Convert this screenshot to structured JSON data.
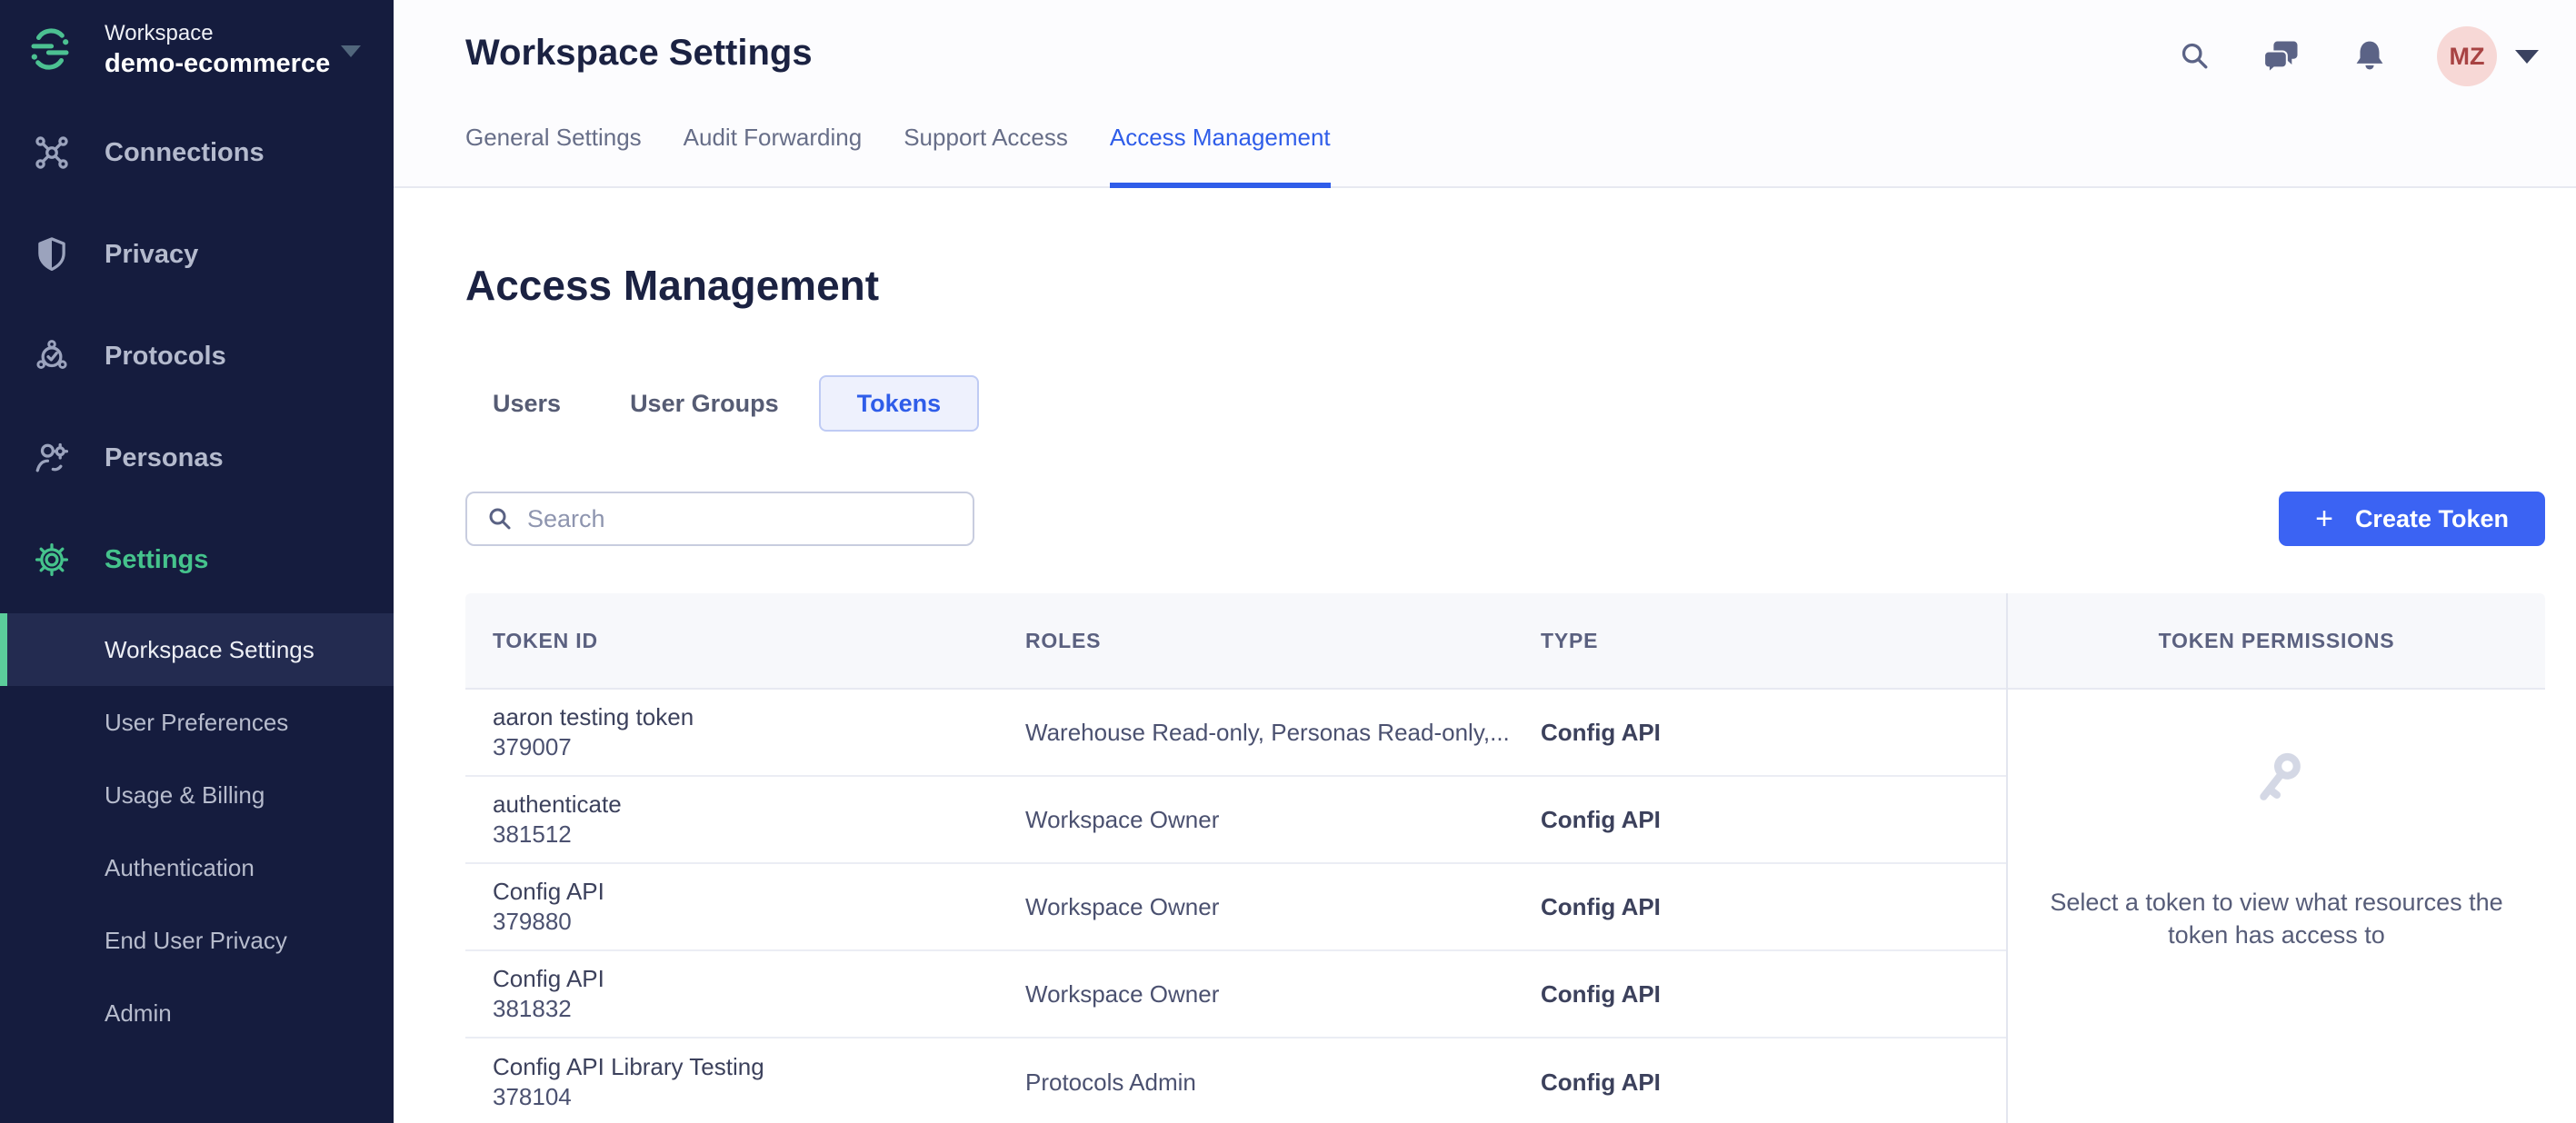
{
  "sidebar": {
    "workspace_label": "Workspace",
    "workspace_name": "demo-ecommerce",
    "items": [
      {
        "label": "Connections",
        "icon": "connections-icon"
      },
      {
        "label": "Privacy",
        "icon": "shield-icon"
      },
      {
        "label": "Protocols",
        "icon": "protocols-icon"
      },
      {
        "label": "Personas",
        "icon": "personas-icon"
      },
      {
        "label": "Settings",
        "icon": "gear-icon",
        "active": true
      }
    ],
    "sub_items": [
      {
        "label": "Workspace Settings",
        "active": true
      },
      {
        "label": "User Preferences"
      },
      {
        "label": "Usage & Billing"
      },
      {
        "label": "Authentication"
      },
      {
        "label": "End User Privacy"
      },
      {
        "label": "Admin"
      }
    ]
  },
  "header": {
    "title": "Workspace Settings",
    "tabs": [
      {
        "label": "General Settings"
      },
      {
        "label": "Audit Forwarding"
      },
      {
        "label": "Support Access"
      },
      {
        "label": "Access Management",
        "active": true
      }
    ],
    "icons": [
      "search-icon",
      "chat-icon",
      "bell-icon"
    ],
    "avatar_initials": "MZ"
  },
  "main": {
    "heading": "Access Management",
    "tabs": [
      {
        "label": "Users"
      },
      {
        "label": "User Groups"
      },
      {
        "label": "Tokens",
        "active": true
      }
    ],
    "search_placeholder": "Search",
    "create_button_plus": "+",
    "create_button_label": "Create Token"
  },
  "table": {
    "columns": [
      "TOKEN ID",
      "ROLES",
      "TYPE"
    ],
    "permissions_header": "TOKEN PERMISSIONS",
    "rows": [
      {
        "name": "aaron testing token",
        "id": "379007",
        "roles": "Warehouse Read-only, Personas Read-only,...",
        "type": "Config API"
      },
      {
        "name": "authenticate",
        "id": "381512",
        "roles": "Workspace Owner",
        "type": "Config API"
      },
      {
        "name": "Config API",
        "id": "379880",
        "roles": "Workspace Owner",
        "type": "Config API"
      },
      {
        "name": "Config API",
        "id": "381832",
        "roles": "Workspace Owner",
        "type": "Config API"
      },
      {
        "name": "Config API Library Testing",
        "id": "378104",
        "roles": "Protocols Admin",
        "type": "Config API"
      }
    ],
    "empty_state": "Select a token to view what resources the token has access to"
  },
  "colors": {
    "sidebar_bg": "#151c3e",
    "accent_green": "#45c38c",
    "accent_blue": "#2f5de9",
    "button_blue": "#3b63f3",
    "avatar_bg": "#f7d8d6",
    "avatar_text": "#a84343"
  }
}
